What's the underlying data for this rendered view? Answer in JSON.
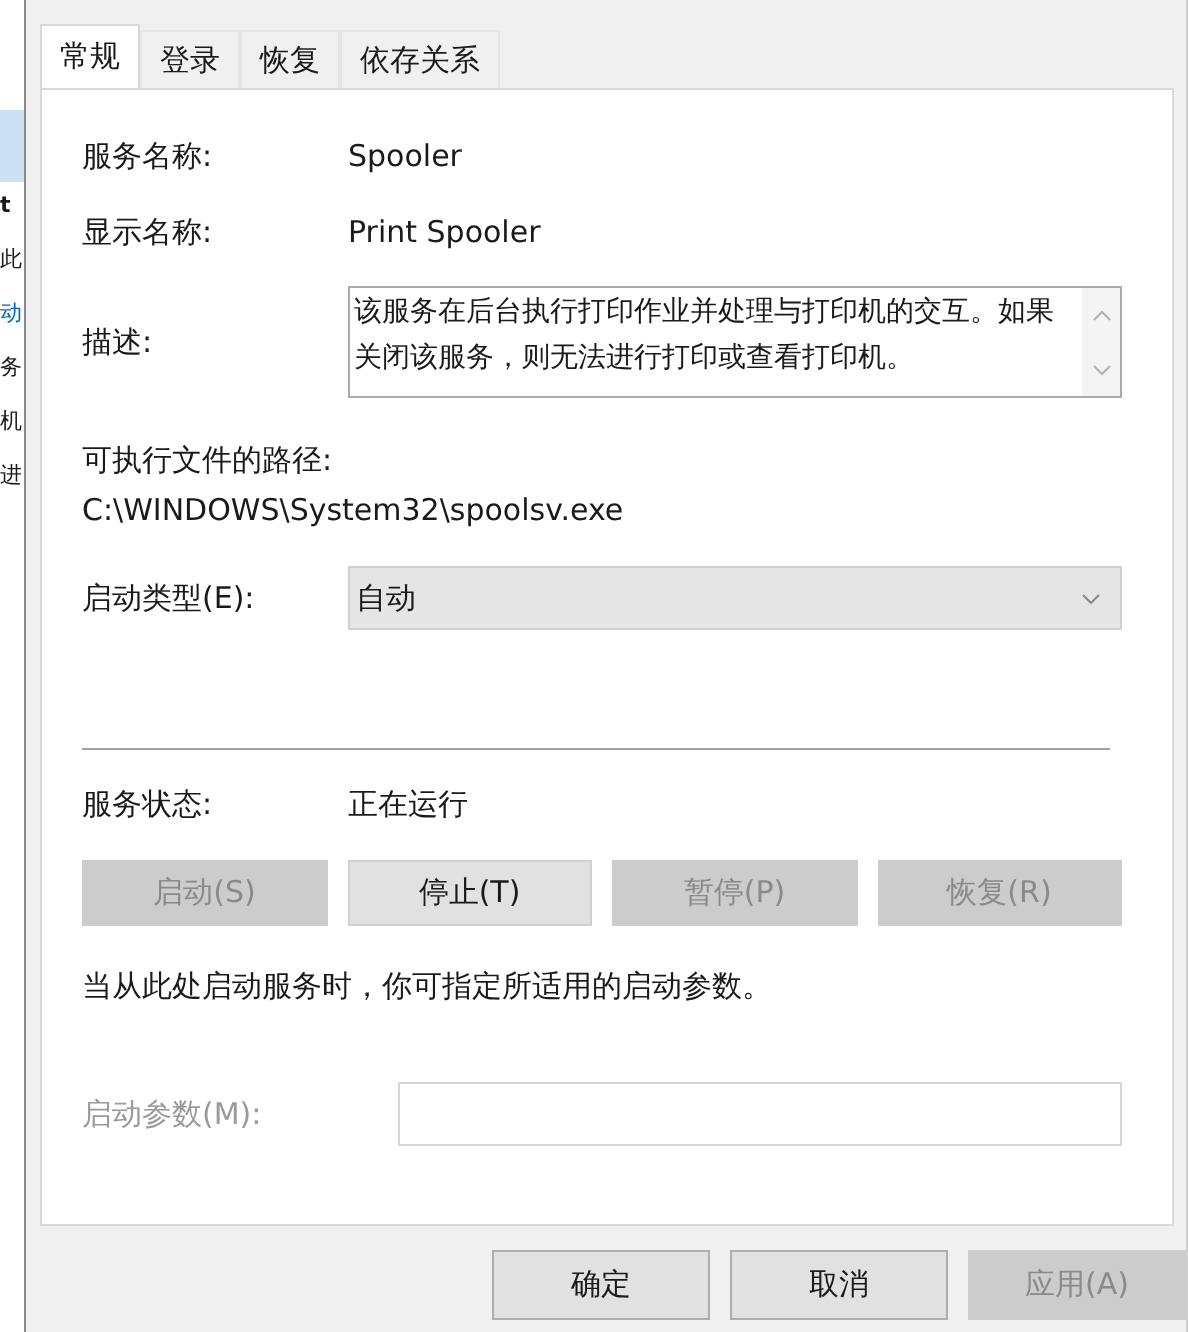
{
  "background_window": {
    "fragments": [
      {
        "text": "t",
        "kind": "bold"
      },
      {
        "text": "此",
        "kind": "text"
      },
      {
        "text": "动",
        "kind": "link"
      },
      {
        "text": "务",
        "kind": "text"
      },
      {
        "text": "机",
        "kind": "text"
      },
      {
        "text": "进",
        "kind": "text"
      }
    ]
  },
  "tabs": [
    {
      "label": "常规",
      "selected": true
    },
    {
      "label": "登录",
      "selected": false
    },
    {
      "label": "恢复",
      "selected": false
    },
    {
      "label": "依存关系",
      "selected": false
    }
  ],
  "fields": [
    {
      "label": "服务名称:",
      "value": "Spooler"
    },
    {
      "label": "显示名称:",
      "value": "Print Spooler"
    }
  ],
  "description": {
    "label": "描述:",
    "value": "该服务在后台执行打印作业并处理与打印机的交互。如果关闭该服务，则无法进行打印或查看打印机。"
  },
  "path": {
    "label": "可执行文件的路径:",
    "value": "C:\\WINDOWS\\System32\\spoolsv.exe"
  },
  "startup_type": {
    "label": "启动类型(E):",
    "value": "自动"
  },
  "status": {
    "label": "服务状态:",
    "value": "正在运行"
  },
  "service_buttons": [
    {
      "label": "启动(S)",
      "disabled": true
    },
    {
      "label": "停止(T)",
      "disabled": false
    },
    {
      "label": "暂停(P)",
      "disabled": true
    },
    {
      "label": "恢复(R)",
      "disabled": true
    }
  ],
  "hint": "当从此处启动服务时，你可指定所适用的启动参数。",
  "start_params": {
    "label": "启动参数(M):",
    "disabled": true
  },
  "dialog_buttons": [
    {
      "label": "确定",
      "disabled": false
    },
    {
      "label": "取消",
      "disabled": false
    },
    {
      "label": "应用(A)",
      "disabled": true
    }
  ]
}
